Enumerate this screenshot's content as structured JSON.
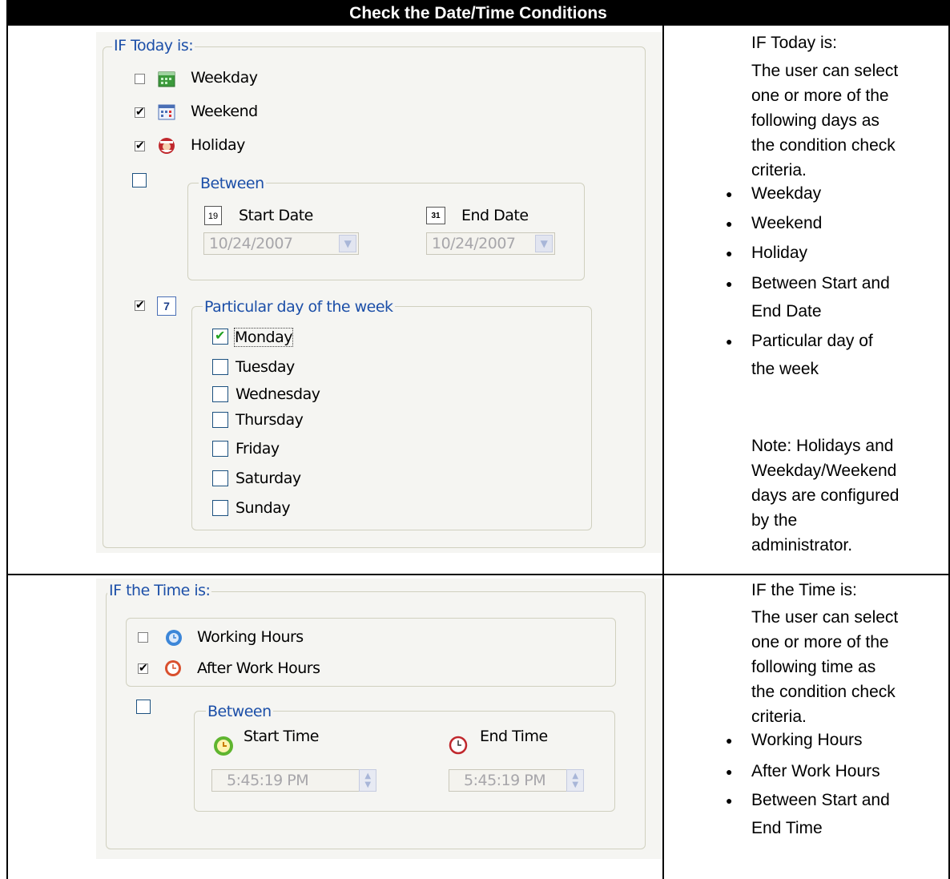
{
  "header": {
    "title": "Check the Date/Time Conditions"
  },
  "date_panel": {
    "group_title": "IF Today is:",
    "weekday": {
      "label": "Weekday",
      "checked": false
    },
    "weekend": {
      "label": "Weekend",
      "checked": true
    },
    "holiday": {
      "label": "Holiday",
      "checked": true
    },
    "between": {
      "checked": false,
      "title": "Between",
      "start_label": "Start Date",
      "start_value": "10/24/2007",
      "start_icon_text": "19",
      "end_label": "End Date",
      "end_value": "10/24/2007",
      "end_icon_text": "31"
    },
    "particular": {
      "checked": true,
      "title": "Particular day of the week",
      "icon_text": "7",
      "days": [
        {
          "label": "Monday",
          "checked": true
        },
        {
          "label": "Tuesday",
          "checked": false
        },
        {
          "label": "Wednesday",
          "checked": false
        },
        {
          "label": "Thursday",
          "checked": false
        },
        {
          "label": "Friday",
          "checked": false
        },
        {
          "label": "Saturday",
          "checked": false
        },
        {
          "label": "Sunday",
          "checked": false
        }
      ]
    }
  },
  "date_desc": {
    "heading": "IF Today is:",
    "intro_lines": [
      "The user can select",
      "one or more of the",
      "following days as",
      "the condition check",
      "criteria."
    ],
    "bullets": [
      "Weekday",
      "Weekend",
      "Holiday",
      "Between Start and",
      "End Date",
      "Particular day of",
      "the week"
    ],
    "note_lines": [
      "Note: Holidays and",
      "Weekday/Weekend",
      "days are configured",
      "by the",
      "administrator."
    ]
  },
  "time_panel": {
    "group_title": "IF the Time is:",
    "working": {
      "label": "Working Hours",
      "checked": false
    },
    "after": {
      "label": "After Work Hours",
      "checked": true
    },
    "between": {
      "checked": false,
      "title": "Between",
      "start_label": "Start Time",
      "start_value": "5:45:19 PM",
      "end_label": "End Time",
      "end_value": "5:45:19 PM"
    }
  },
  "time_desc": {
    "heading": "IF the Time is:",
    "intro_lines": [
      "The user can select",
      "one or more of the",
      "following time as",
      "the condition check",
      "criteria."
    ],
    "bullets": [
      "Working Hours",
      "After Work Hours",
      "Between Start and",
      "End Time"
    ]
  }
}
